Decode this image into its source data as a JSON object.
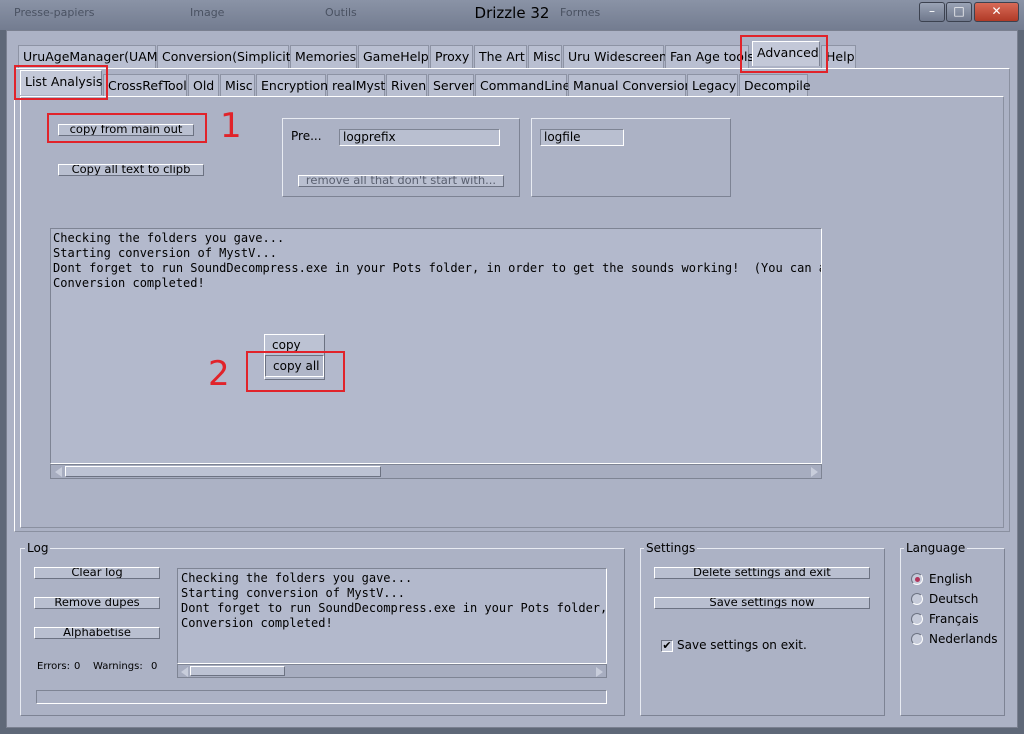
{
  "window": {
    "title": "Drizzle 32",
    "background_labels": [
      "Presse-papiers",
      "Image",
      "Outils",
      "Formes"
    ],
    "minimize_glyph": "–",
    "maximize_glyph": "□",
    "close_glyph": "✕"
  },
  "main_tabs": [
    "UruAgeManager(UAM)",
    "Conversion(Simplicity)",
    "Memories",
    "GameHelp",
    "Proxy",
    "The Art",
    "Misc",
    "Uru Widescreen",
    "Fan Age tools",
    "Advanced",
    "Help"
  ],
  "sub_tabs": [
    "List Analysis",
    "CrossRefTool",
    "Old",
    "Misc",
    "Encryption",
    "realMyst",
    "Riven",
    "Server",
    "CommandLine",
    "Manual Conversion",
    "Legacy",
    "Decompile"
  ],
  "list_analysis": {
    "copy_from_main_out": "copy from main out",
    "copy_all_to_clipb": "Copy all text to clipb",
    "prefix_label": "Pre...",
    "prefix_value": "logprefix",
    "remove_button": "remove all that don't start with...",
    "logfile_value": "logfile",
    "output_lines": [
      "Checking the folders you gave...",
      "Starting conversion of MystV...",
      "Dont forget to run SoundDecompress.exe in your Pots folder, in order to get the sounds working!  (You can also",
      "Conversion completed!"
    ],
    "context_menu": [
      "copy",
      "copy all"
    ]
  },
  "annotations": [
    "1",
    "2"
  ],
  "log": {
    "title": "Log",
    "clear": "Clear log",
    "remove_dupes": "Remove dupes",
    "alphabetise": "Alphabetise",
    "errors_label": "Errors:",
    "errors_value": "0",
    "warnings_label": "Warnings:",
    "warnings_value": "0",
    "lines": [
      "Checking the folders you gave...",
      "Starting conversion of MystV...",
      "Dont forget to run SoundDecompress.exe in your Pots folder, i",
      "Conversion completed!"
    ]
  },
  "settings": {
    "title": "Settings",
    "delete": "Delete settings and exit",
    "save": "Save settings now",
    "save_on_exit": "Save settings on exit.",
    "save_on_exit_checked": true
  },
  "language": {
    "title": "Language",
    "options": [
      "English",
      "Deutsch",
      "Français",
      "Nederlands"
    ],
    "selected": "English"
  },
  "colors": {
    "accent_red": "#e1232a",
    "radio_dot": "#b2355b"
  }
}
